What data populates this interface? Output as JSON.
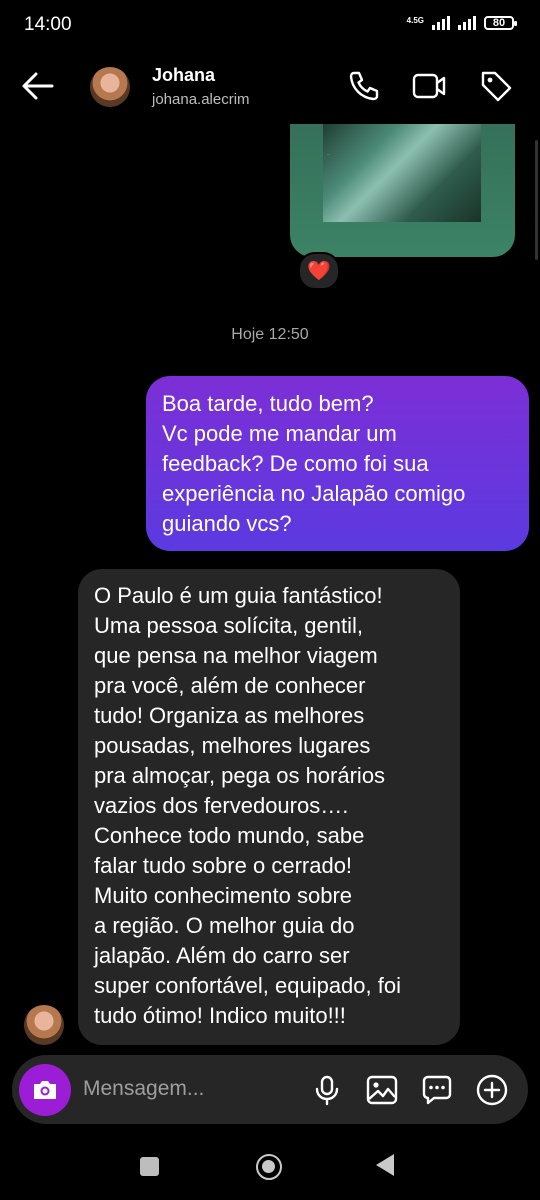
{
  "status_bar": {
    "time": "14:00",
    "network": "4.5G",
    "battery": "80"
  },
  "header": {
    "name": "Johana",
    "username": "johana.alecrim"
  },
  "shared_post": {
    "caption": "...",
    "reaction": "❤️"
  },
  "conversation": {
    "timestamp": "Hoje 12:50",
    "outgoing_message_lines": [
      "Boa tarde, tudo bem?",
      "Vc pode me mandar um",
      "feedback? De como foi sua",
      "experiência no Jalapão comigo",
      "guiando vcs?"
    ],
    "incoming_message_lines": [
      "O Paulo é um guia fantástico!",
      "Uma pessoa solícita, gentil,",
      "que pensa na melhor viagem",
      "pra você, além de conhecer",
      "tudo! Organiza as melhores",
      "pousadas, melhores lugares",
      "pra almoçar, pega os horários",
      "vazios dos fervedouros….",
      "Conhece todo mundo, sabe",
      "falar tudo sobre o cerrado!",
      "Muito conhecimento sobre",
      "a região. O melhor guia do",
      "jalapão. Além do carro ser",
      "super confortável, equipado, foi",
      "tudo ótimo! Indico muito!!!"
    ]
  },
  "composer": {
    "placeholder": "Mensagem..."
  },
  "icons": {
    "header": [
      "back-arrow-icon",
      "phone-icon",
      "video-camera-icon",
      "tag-icon"
    ],
    "composer": [
      "camera-icon",
      "microphone-icon",
      "gallery-icon",
      "sticker-icon",
      "plus-icon"
    ]
  },
  "colors": {
    "background": "#000000",
    "outgoing_bubble_top": "#7c2fd6",
    "outgoing_bubble_bottom": "#5b3ae0",
    "incoming_bubble": "#262626",
    "camera_button": "#9b1ed6",
    "shared_post": "#3c8366"
  }
}
